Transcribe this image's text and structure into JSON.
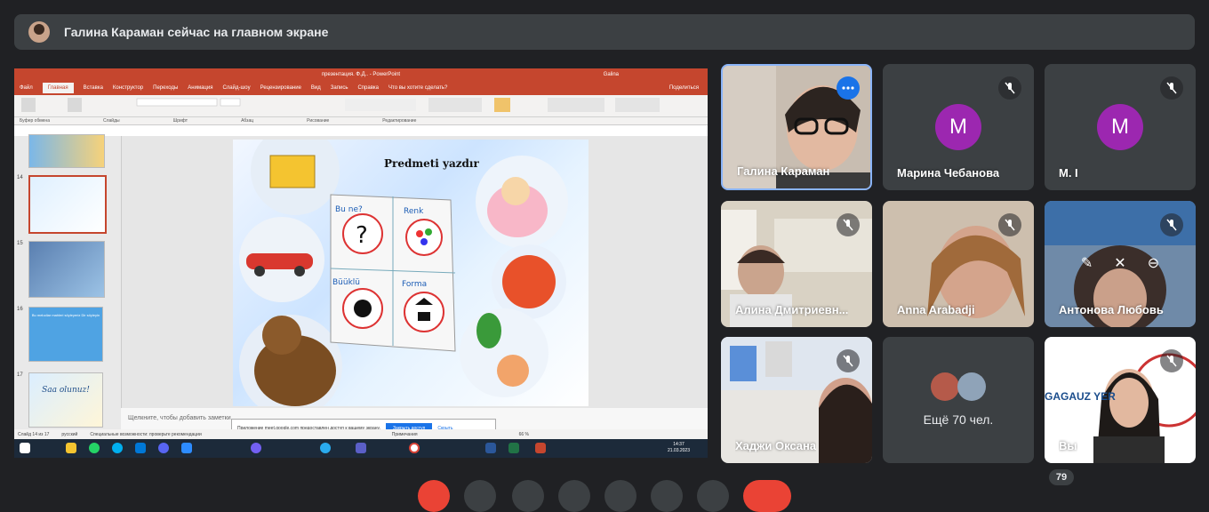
{
  "banner": {
    "text": "Галина Караман сейчас на главном экране"
  },
  "ppt": {
    "window_title": "презентация. Ф.Д.. - PowerPoint",
    "user": "Galina",
    "tabs": [
      "Файл",
      "Главная",
      "Вставка",
      "Конструктор",
      "Переходы",
      "Анимация",
      "Слайд-шоу",
      "Рецензирование",
      "Вид",
      "Запись",
      "Справка",
      "Что вы хотите сделать?"
    ],
    "share_label": "Поделиться",
    "groups": [
      "Буфер обмена",
      "Слайды",
      "Шрифт",
      "Абзац",
      "Рисование",
      "Редактирование"
    ],
    "thumb_numbers": [
      "14",
      "15",
      "16",
      "17"
    ],
    "thumb16_text": "Bu melodiar mahleri söyleyeriz Dir söyleyin",
    "thumb17_text": "Saa olunuz!",
    "slide_title": "Predmeti yazdır",
    "cards": [
      "Bu ne?",
      "Renk",
      "Büüklü",
      "Forma"
    ],
    "notes_placeholder": "Щелкните, чтобы добавить заметки",
    "permission_text": "Приложение meet.google.com предоставлен доступ к вашему экрану.",
    "permission_button": "Закрыть доступ",
    "permission_link": "Скрыть",
    "status_slide": "Слайд 14 из 17",
    "status_lang": "русский",
    "status_access": "Специальные возможности: проверьте рекомендации",
    "status_notes": "Примечания",
    "status_zoom": "66 %",
    "clock_time": "14:37",
    "clock_date": "21.03.2023"
  },
  "participants": [
    {
      "name": "Галина Караман",
      "type": "video"
    },
    {
      "name": "Марина Чебанова",
      "type": "avatar",
      "initial": "M",
      "muted": true
    },
    {
      "name": "М. I",
      "type": "avatar",
      "initial": "M",
      "muted": true
    },
    {
      "name": "Алина Дмитриевн...",
      "type": "video",
      "muted": true
    },
    {
      "name": "Anna Arabadji",
      "type": "video",
      "muted": true
    },
    {
      "name": "Антонова Любовь",
      "type": "video",
      "muted": true
    },
    {
      "name": "Хаджи Оксана",
      "type": "video",
      "muted": true
    },
    {
      "name": "Ещё 70 чел.",
      "type": "more"
    },
    {
      "name": "Вы",
      "type": "video",
      "muted": true
    }
  ],
  "self_logo_text": "GAGAUZ YER",
  "participant_count": "79",
  "colors": {
    "bg": "#202124",
    "tile": "#3c4043",
    "accent": "#8ab4f8",
    "avatar": "#9c27b0",
    "ppt": "#c5462e"
  }
}
